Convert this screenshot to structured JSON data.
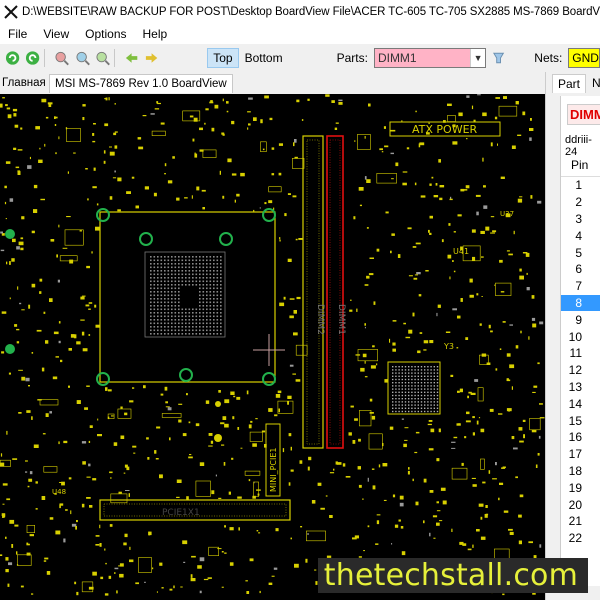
{
  "window": {
    "title": "D:\\WEBSITE\\RAW BACKUP FOR POST\\Desktop BoardView File\\ACER TC-605 TC-705 SX2885 MS-7869 BoardView File\\MSI MS-78"
  },
  "menu": [
    "File",
    "View",
    "Options",
    "Help"
  ],
  "toolbar": {
    "top_label": "Top",
    "bottom_label": "Bottom",
    "parts_label": "Parts:",
    "parts_value": "DIMM1",
    "nets_label": "Nets:",
    "nets_value": "GND"
  },
  "tabs": [
    "Главная",
    "MSI MS-7869 Rev 1.0 BoardView"
  ],
  "board": {
    "labels": {
      "atx_power": "ATX POWER",
      "dimm1": "DIMM1",
      "dimm2": "DIMM2",
      "mini_pcie": "MINI_PCIE1",
      "pcie": "PCIE1X1",
      "u41": "U41",
      "y3": "Y3",
      "u37": "U37",
      "u48": "U48"
    },
    "colors": {
      "background": "#000000",
      "trace": "#d8d000",
      "via": "#22b14c",
      "highlight": "#e01010"
    }
  },
  "right_panel": {
    "tabs": [
      "Part",
      "N"
    ],
    "part_name": "DIMM",
    "part_desc": "ddriii-24",
    "column_header": "Pin",
    "pins": [
      "1",
      "2",
      "3",
      "4",
      "5",
      "6",
      "7",
      "8",
      "9",
      "10",
      "11",
      "12",
      "13",
      "14",
      "15",
      "16",
      "17",
      "18",
      "19",
      "20",
      "21",
      "22"
    ],
    "selected_pin": "8"
  },
  "watermark": "thetechstall.com"
}
